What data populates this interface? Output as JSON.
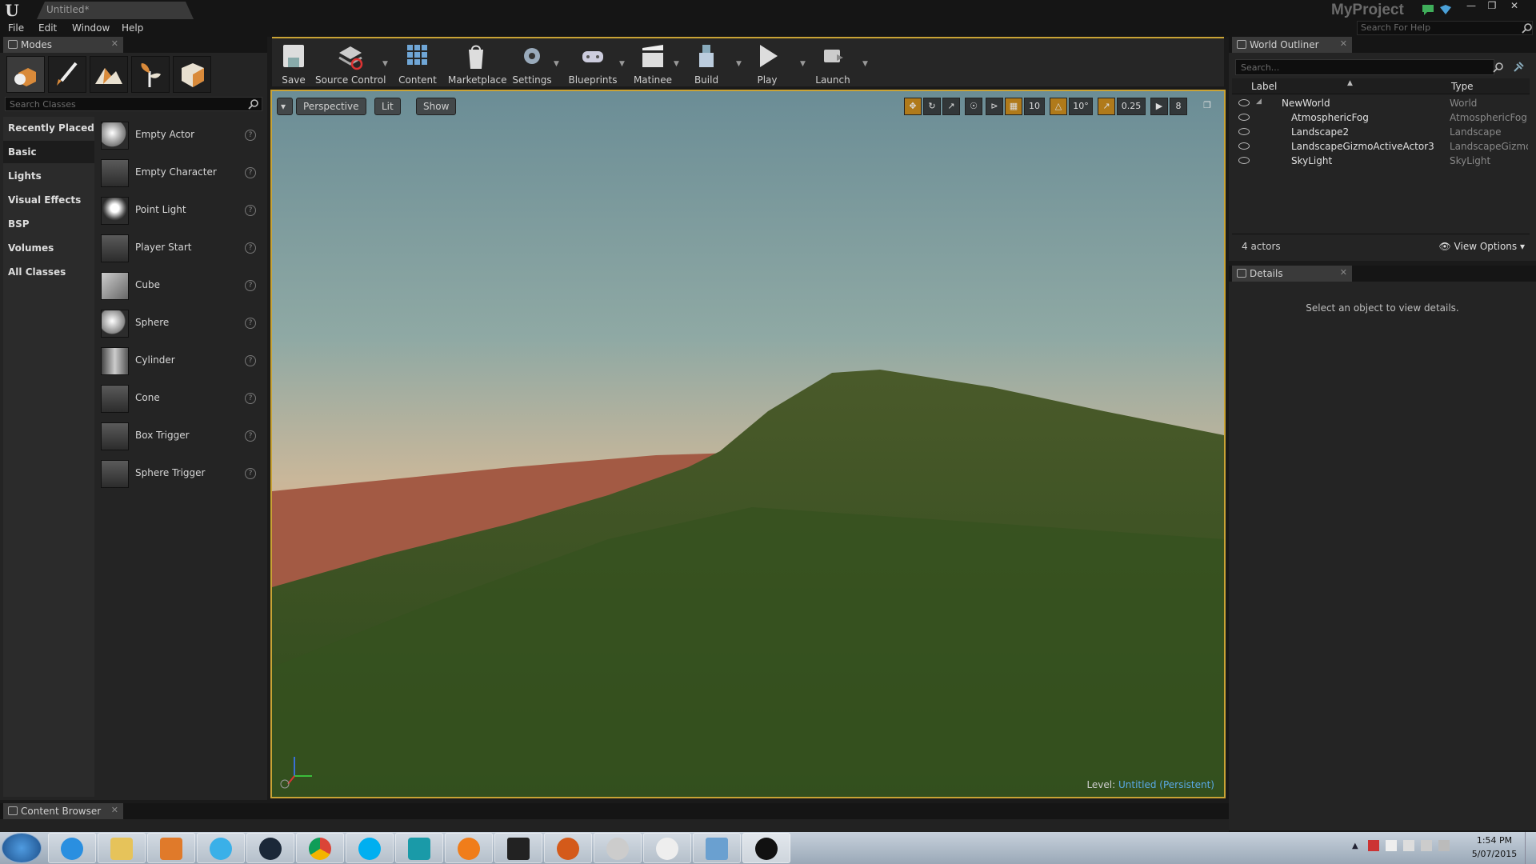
{
  "title_bar": {
    "document_tab": "Untitled*",
    "project": "MyProject"
  },
  "menu": [
    "File",
    "Edit",
    "Window",
    "Help"
  ],
  "help_search": {
    "placeholder": "Search For Help"
  },
  "modes_panel": {
    "tab": "Modes",
    "search_placeholder": "Search Classes",
    "categories": [
      "Recently Placed",
      "Basic",
      "Lights",
      "Visual Effects",
      "BSP",
      "Volumes",
      "All Classes"
    ],
    "active_category": "Basic",
    "items": [
      "Empty Actor",
      "Empty Character",
      "Point Light",
      "Player Start",
      "Cube",
      "Sphere",
      "Cylinder",
      "Cone",
      "Box Trigger",
      "Sphere Trigger"
    ]
  },
  "toolbar": {
    "save": "Save",
    "source_control": "Source Control",
    "content": "Content",
    "marketplace": "Marketplace",
    "settings": "Settings",
    "blueprints": "Blueprints",
    "matinee": "Matinee",
    "build": "Build",
    "play": "Play",
    "launch": "Launch"
  },
  "viewport": {
    "perspective": "Perspective",
    "lit": "Lit",
    "show": "Show",
    "grid_snap": "10",
    "rotation_snap": "10°",
    "scale_snap": "0.25",
    "camera_speed": "8",
    "level_prefix": "Level:",
    "level_name": "Untitled (Persistent)"
  },
  "outliner": {
    "tab": "World Outliner",
    "search_placeholder": "Search...",
    "col_label": "Label",
    "col_type": "Type",
    "rows": [
      {
        "label": "NewWorld",
        "type": "World"
      },
      {
        "label": "AtmosphericFog",
        "type": "AtmosphericFog"
      },
      {
        "label": "Landscape2",
        "type": "Landscape"
      },
      {
        "label": "LandscapeGizmoActiveActor3",
        "type": "LandscapeGizmoA"
      },
      {
        "label": "SkyLight",
        "type": "SkyLight"
      }
    ],
    "count": "4 actors",
    "view_options": "View Options"
  },
  "details": {
    "tab": "Details",
    "empty_message": "Select an object to view details."
  },
  "content_browser": {
    "tab": "Content Browser"
  },
  "clock": {
    "time": "1:54 PM",
    "date": "5/07/2015"
  }
}
